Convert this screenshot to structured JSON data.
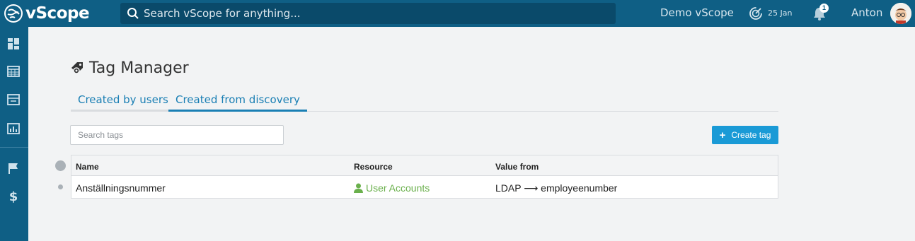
{
  "app": {
    "name": "vScope"
  },
  "header": {
    "search_placeholder": "Search vScope for anything...",
    "workspace": "Demo vScope",
    "date": "25 Jan",
    "notification_count": "1",
    "username": "Anton"
  },
  "sidebar": {
    "items": [
      {
        "icon": "dashboard-icon"
      },
      {
        "icon": "table-icon"
      },
      {
        "icon": "window-icon"
      },
      {
        "icon": "report-icon"
      },
      {
        "icon": "flag-icon"
      },
      {
        "icon": "dollar-icon"
      }
    ]
  },
  "page": {
    "title": "Tag Manager",
    "tabs": [
      {
        "label": "Created by users",
        "active": false
      },
      {
        "label": "Created from discovery",
        "active": true
      }
    ],
    "search_placeholder": "Search tags",
    "create_label": "Create tag",
    "create_icon": "+"
  },
  "table": {
    "headers": [
      "Name",
      "Resource",
      "Value from"
    ],
    "rows": [
      {
        "name": "Anställningsnummer",
        "resource": "User Accounts",
        "value_from": "LDAP ⟶ employeenumber"
      }
    ]
  },
  "colors": {
    "topbar": "#0f5f85",
    "accent": "#1a9ad6",
    "link": "#1a7fb4",
    "resource_green": "#6ab04c"
  }
}
